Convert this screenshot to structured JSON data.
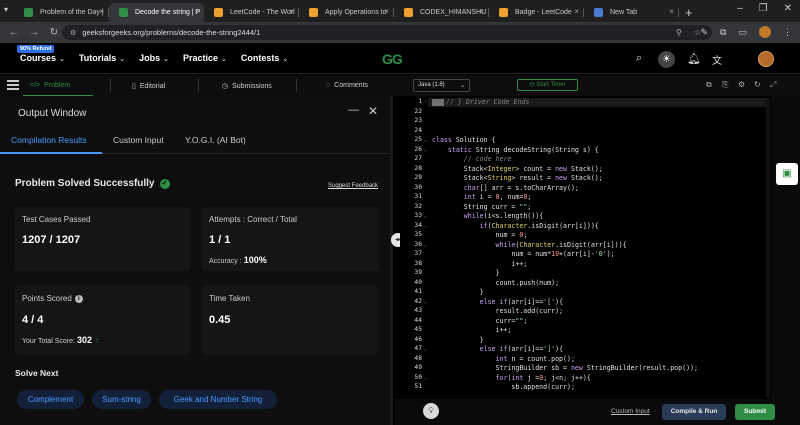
{
  "browser": {
    "tabs": [
      {
        "label": "Problem of the Day | ",
        "color": "#2f8d46",
        "active": false
      },
      {
        "label": "Decode the string | P",
        "color": "#2f8d46",
        "active": true
      },
      {
        "label": "LeetCode - The Worl",
        "color": "#f0a030",
        "active": false
      },
      {
        "label": "Apply Operations to",
        "color": "#f0a030",
        "active": false
      },
      {
        "label": "CODEX_HIMANSHU",
        "color": "#f0a030",
        "active": false
      },
      {
        "label": "Badge - LeetCode",
        "color": "#f0a030",
        "active": false
      },
      {
        "label": "New Tab",
        "color": "#4a7bd0",
        "active": false
      }
    ],
    "url": "geeksforgeeks.org/problems/decode-the-string2444/1"
  },
  "gfg_header": {
    "refund_badge": "90% Refund",
    "menu": [
      "Courses",
      "Tutorials",
      "Jobs",
      "Practice",
      "Contests"
    ],
    "logo": "GG"
  },
  "problem_toolbar": {
    "tabs": [
      "Problem",
      "Editorial",
      "Submissions",
      "Comments"
    ],
    "language": "Java (1.8)",
    "timer_label": "Start Timer"
  },
  "output_window": {
    "title": "Output Window",
    "tabs": [
      "Compilation Results",
      "Custom Input",
      "Y.O.G.I. (AI Bot)"
    ],
    "status": "Problem Solved Successfully",
    "feedback_link": "Suggest Feedback",
    "test_cases_label": "Test Cases Passed",
    "test_cases_value": "1207 / 1207",
    "attempts_label": "Attempts : Correct / Total",
    "attempts_value": "1 / 1",
    "accuracy_label": "Accuracy :",
    "accuracy_value": "100%",
    "points_label": "Points Scored",
    "points_value": "4 / 4",
    "total_score_label": "Your Total Score:",
    "total_score_value": "302",
    "time_label": "Time Taken",
    "time_value": "0.45",
    "solve_next_title": "Solve Next",
    "solve_next": [
      "Complement",
      "Sum-string",
      "Geek and Number String"
    ]
  },
  "editor": {
    "lines": [
      {
        "n": "1",
        "fold": "›",
        "html": "<span class=\"cm\">// } Driver Code Ends</span>"
      },
      {
        "n": "22",
        "fold": "",
        "html": ""
      },
      {
        "n": "23",
        "fold": "",
        "html": ""
      },
      {
        "n": "24",
        "fold": "",
        "html": ""
      },
      {
        "n": "25",
        "fold": "⌄",
        "html": "<span class=\"kw\">class</span> Solution {"
      },
      {
        "n": "26",
        "fold": "⌄",
        "html": "    <span class=\"kw\">static</span> String decodeString(String s) {"
      },
      {
        "n": "27",
        "fold": "",
        "html": "        <span class=\"cm\">// code here</span>"
      },
      {
        "n": "28",
        "fold": "",
        "html": "        Stack&lt;<span class=\"ty\">Integer</span>&gt; count = <span class=\"kw\">new</span> Stack();"
      },
      {
        "n": "29",
        "fold": "",
        "html": "        Stack&lt;<span class=\"ty\">String</span>&gt; result = <span class=\"kw\">new</span> Stack();"
      },
      {
        "n": "30",
        "fold": "",
        "html": "        <span class=\"kw\">char</span>[] arr = s.toCharArray();"
      },
      {
        "n": "31",
        "fold": "",
        "html": "        <span class=\"kw\">int</span> i = <span class=\"nm\">0</span>, num=<span class=\"nm\">0</span>;"
      },
      {
        "n": "32",
        "fold": "",
        "html": "        String curr = <span class=\"st\">\"\"</span>;"
      },
      {
        "n": "33",
        "fold": "⌄",
        "html": "        <span class=\"kw\">while</span>(i&lt;s.length()){"
      },
      {
        "n": "34",
        "fold": "⌄",
        "html": "            <span class=\"kw\">if</span>(<span class=\"ty\">Character</span>.isDigit(arr[i])){"
      },
      {
        "n": "35",
        "fold": "",
        "html": "                num = <span class=\"nm\">0</span>;"
      },
      {
        "n": "36",
        "fold": "⌄",
        "html": "                <span class=\"kw\">while</span>(<span class=\"ty\">Character</span>.isDigit(arr[i])){"
      },
      {
        "n": "37",
        "fold": "",
        "html": "                    num = num*<span class=\"nm\">10</span>+(arr[i]-<span class=\"st\">'0'</span>);"
      },
      {
        "n": "38",
        "fold": "",
        "html": "                    i++;"
      },
      {
        "n": "39",
        "fold": "",
        "html": "                }"
      },
      {
        "n": "40",
        "fold": "",
        "html": "                count.push(num);"
      },
      {
        "n": "41",
        "fold": "",
        "html": "            }"
      },
      {
        "n": "42",
        "fold": "⌄",
        "html": "            <span class=\"kw\">else if</span>(arr[i]==<span class=\"st\">'['</span>){"
      },
      {
        "n": "43",
        "fold": "",
        "html": "                result.add(curr);"
      },
      {
        "n": "44",
        "fold": "",
        "html": "                curr=<span class=\"st\">\"\"</span>;"
      },
      {
        "n": "45",
        "fold": "",
        "html": "                i++;"
      },
      {
        "n": "46",
        "fold": "",
        "html": "            }"
      },
      {
        "n": "47",
        "fold": "⌄",
        "html": "            <span class=\"kw\">else if</span>(arr[i]==<span class=\"st\">']'</span>){"
      },
      {
        "n": "48",
        "fold": "",
        "html": "                <span class=\"kw\">int</span> n = count.pop();"
      },
      {
        "n": "49",
        "fold": "",
        "html": "                StringBuilder sb = <span class=\"kw\">new</span> StringBuilder(result.pop());"
      },
      {
        "n": "50",
        "fold": "⌄",
        "html": "                <span class=\"kw\">for</span>(<span class=\"kw\">int</span> j =<span class=\"nm\">0</span>; j&lt;n; j++){"
      },
      {
        "n": "51",
        "fold": "",
        "html": "                    sb.append(curr);"
      }
    ]
  },
  "actions": {
    "custom_input": "Custom Input",
    "compile_run": "Compile & Run",
    "submit": "Submit"
  }
}
